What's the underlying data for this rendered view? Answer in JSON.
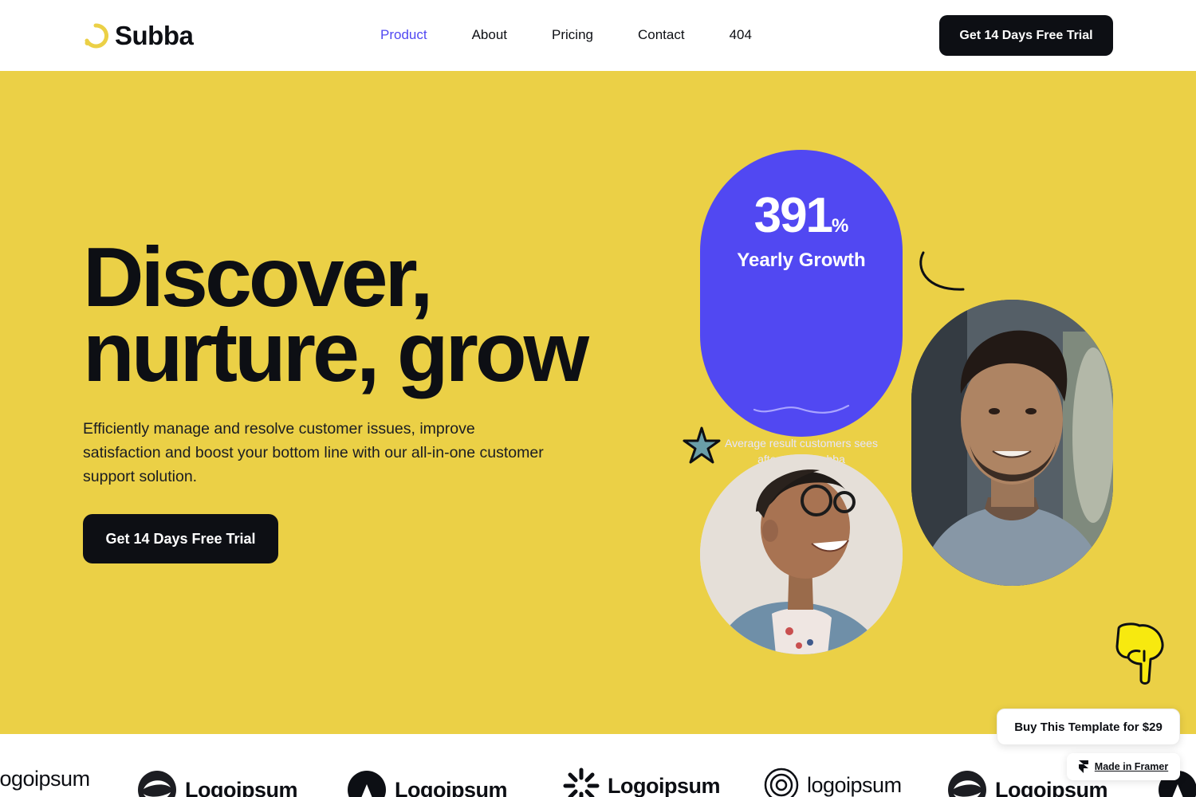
{
  "nav": {
    "brand": "Subba",
    "links": [
      {
        "label": "Product",
        "active": true
      },
      {
        "label": "About",
        "active": false
      },
      {
        "label": "Pricing",
        "active": false
      },
      {
        "label": "Contact",
        "active": false
      },
      {
        "label": "404",
        "active": false
      }
    ],
    "cta": "Get 14 Days Free Trial"
  },
  "hero": {
    "headline_line1": "Discover,",
    "headline_line2": "nurture, grow",
    "subtext": "Efficiently manage and resolve customer issues, improve satisfaction and boost your bottom line with our all-in-one customer support solution.",
    "cta": "Get 14 Days Free Trial",
    "stat": {
      "value": "391",
      "unit": "%",
      "label": "Yearly Growth",
      "description": "Average result customers sees after using Subba"
    }
  },
  "logos": [
    "logoipsum",
    "Logoipsum",
    "Logoipsum",
    "Logoipsum",
    "logoipsum",
    "Logoipsum"
  ],
  "badges": {
    "buy_template": "Buy This Template for $29",
    "made_in_framer": "Made in Framer"
  },
  "colors": {
    "accent": "#5148f2",
    "hero_bg": "#ebd046",
    "dark": "#0d0f14"
  },
  "icons": [
    "subba-logo-icon",
    "star-doodle-icon",
    "arc-doodle-icon",
    "pointing-hand-icon",
    "wave-icon",
    "framer-icon"
  ]
}
